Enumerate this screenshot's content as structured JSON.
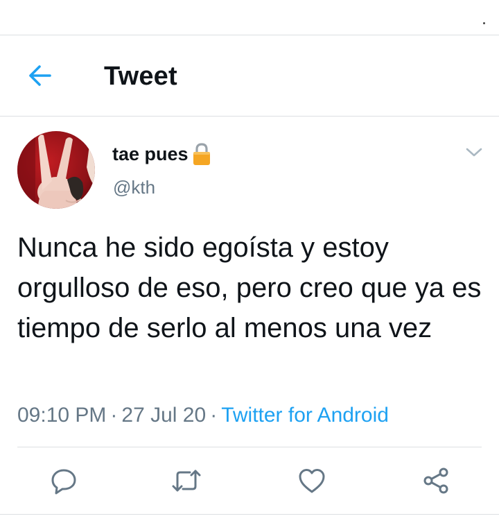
{
  "header": {
    "title": "Tweet",
    "back_icon": "arrow-left-icon"
  },
  "tweet": {
    "author": {
      "display_name": "tae pues",
      "handle": "@kth",
      "protected_icon": "lock-icon",
      "avatar_icon": "peace-sign-hand-avatar"
    },
    "text": "Nunca he sido egoísta y estoy orgulloso de eso, pero creo que ya es tiempo de serlo al menos una vez",
    "time": "09:10 PM",
    "date": "27 Jul 20",
    "separator": "·",
    "source": "Twitter for Android"
  },
  "actions": [
    {
      "name": "reply",
      "icon": "reply-icon"
    },
    {
      "name": "retweet",
      "icon": "retweet-icon"
    },
    {
      "name": "like",
      "icon": "heart-icon"
    },
    {
      "name": "share",
      "icon": "share-icon"
    }
  ],
  "colors": {
    "accent": "#1da1f2",
    "secondary_text": "#657786",
    "primary_text": "#0f1419",
    "divider": "#dcdfe2",
    "lock": "#f5a623"
  }
}
